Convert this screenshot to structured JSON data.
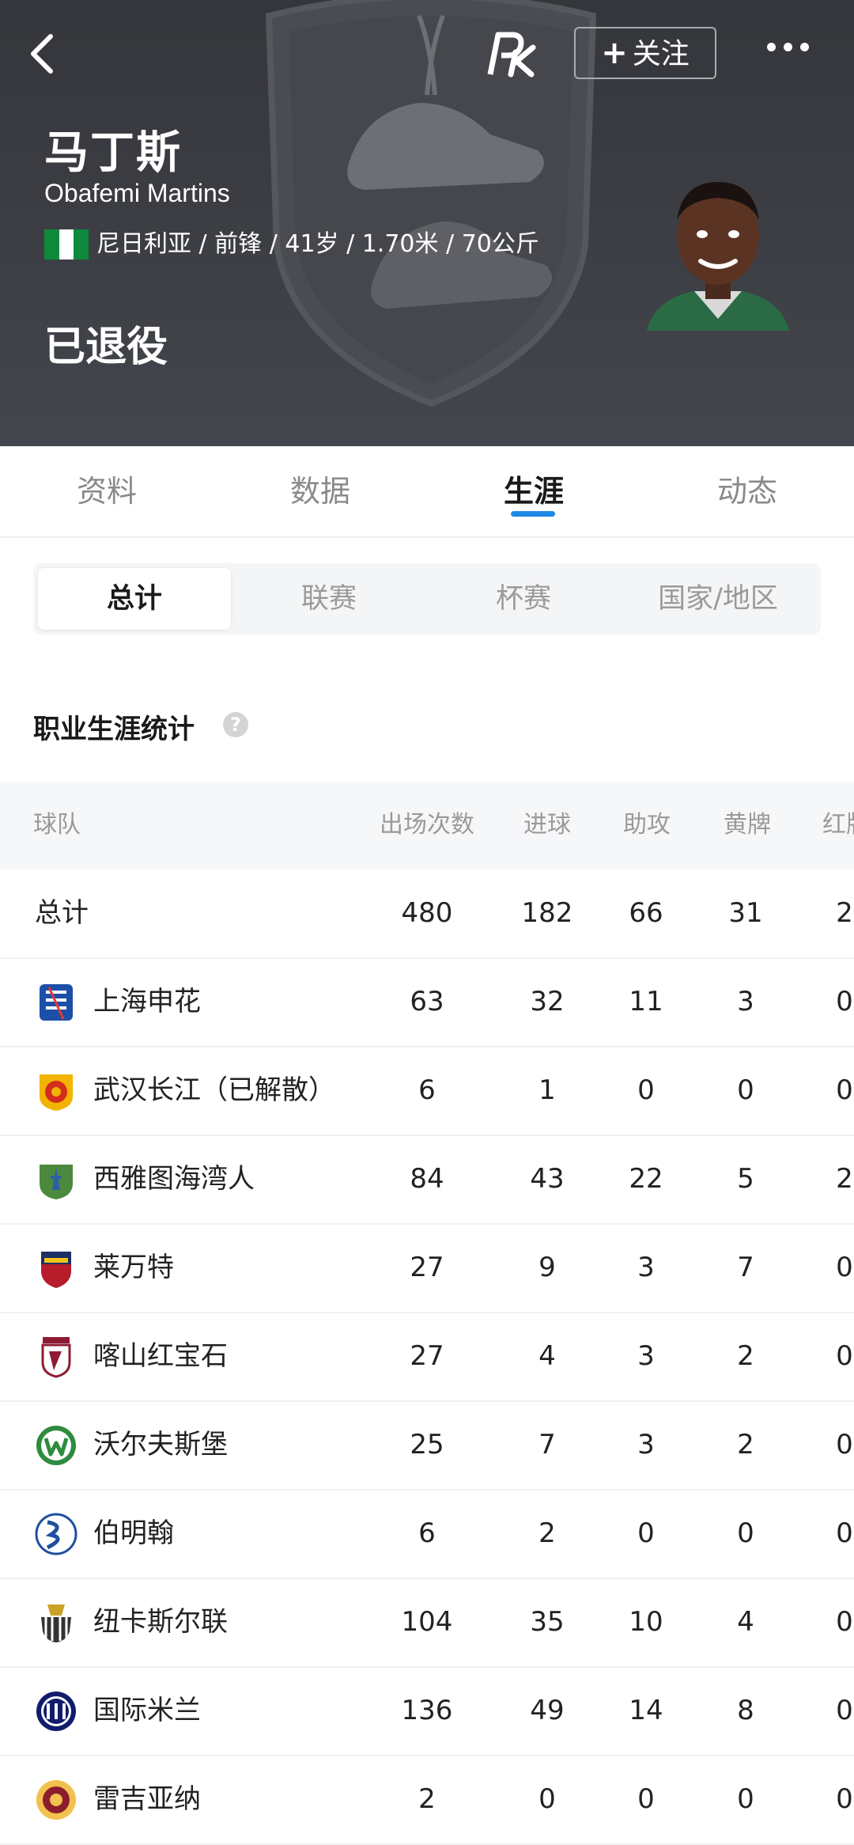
{
  "header": {
    "follow_label": "关注",
    "name_cn": "马丁斯",
    "name_en": "Obafemi Martins",
    "info": "尼日利亚 / 前锋 / 41岁 / 1.70米 / 70公斤",
    "status": "已退役",
    "colors": {
      "background": "#3a3c42",
      "flag_green": "#0f8a3c"
    }
  },
  "tabs": [
    {
      "label": "资料"
    },
    {
      "label": "数据"
    },
    {
      "label": "生涯",
      "active": true
    },
    {
      "label": "动态"
    }
  ],
  "segments": [
    {
      "label": "总计",
      "active": true
    },
    {
      "label": "联赛"
    },
    {
      "label": "杯赛"
    },
    {
      "label": "国家/地区"
    }
  ],
  "section": {
    "title": "职业生涯统计"
  },
  "table": {
    "headers": [
      "球队",
      "出场次数",
      "进球",
      "助攻",
      "黄牌",
      "红牌"
    ],
    "rows": [
      {
        "team": "总计",
        "apps": "480",
        "goals": "182",
        "assists": "66",
        "yellow": "31",
        "red": "2"
      },
      {
        "team": "上海申花",
        "logo": "shanghai-shenhua-logo",
        "apps": "63",
        "goals": "32",
        "assists": "11",
        "yellow": "3",
        "red": "0"
      },
      {
        "team": "武汉长江（已解散）",
        "logo": "wuhan-changjiang-logo",
        "apps": "6",
        "goals": "1",
        "assists": "0",
        "yellow": "0",
        "red": "0"
      },
      {
        "team": "西雅图海湾人",
        "logo": "seattle-sounders-logo",
        "apps": "84",
        "goals": "43",
        "assists": "22",
        "yellow": "5",
        "red": "2"
      },
      {
        "team": "莱万特",
        "logo": "levante-logo",
        "apps": "27",
        "goals": "9",
        "assists": "3",
        "yellow": "7",
        "red": "0"
      },
      {
        "team": "喀山红宝石",
        "logo": "rubin-kazan-logo",
        "apps": "27",
        "goals": "4",
        "assists": "3",
        "yellow": "2",
        "red": "0"
      },
      {
        "team": "沃尔夫斯堡",
        "logo": "wolfsburg-logo",
        "apps": "25",
        "goals": "7",
        "assists": "3",
        "yellow": "2",
        "red": "0"
      },
      {
        "team": "伯明翰",
        "logo": "birmingham-logo",
        "apps": "6",
        "goals": "2",
        "assists": "0",
        "yellow": "0",
        "red": "0"
      },
      {
        "team": "纽卡斯尔联",
        "logo": "newcastle-logo",
        "apps": "104",
        "goals": "35",
        "assists": "10",
        "yellow": "4",
        "red": "0"
      },
      {
        "team": "国际米兰",
        "logo": "inter-milan-logo",
        "apps": "136",
        "goals": "49",
        "assists": "14",
        "yellow": "8",
        "red": "0"
      },
      {
        "team": "雷吉亚纳",
        "logo": "reggiana-logo",
        "apps": "2",
        "goals": "0",
        "assists": "0",
        "yellow": "0",
        "red": "0"
      }
    ]
  }
}
